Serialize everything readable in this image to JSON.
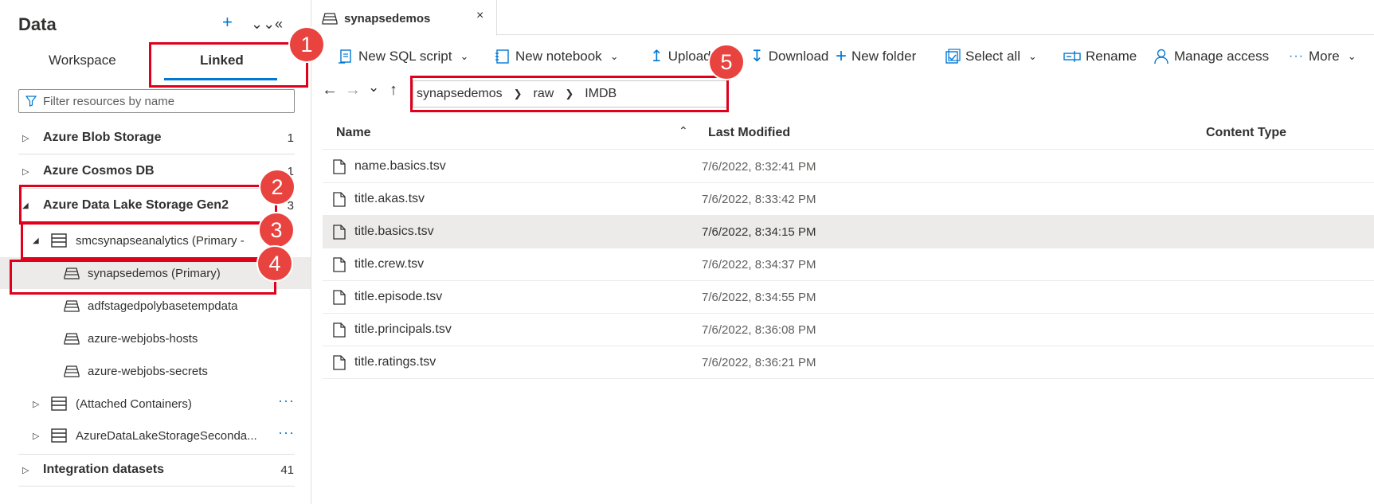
{
  "sidebar": {
    "title": "Data",
    "tabs": [
      "Workspace",
      "Linked"
    ],
    "active_tab": "Linked",
    "filter_placeholder": "Filter resources by name",
    "tree": [
      {
        "label": "Azure Blob Storage",
        "count": "1"
      },
      {
        "label": "Azure Cosmos DB",
        "count": "1"
      },
      {
        "label": "Azure Data Lake Storage Gen2",
        "count": "3"
      },
      {
        "label": "smcsynapseanalytics (Primary - "
      },
      {
        "label": "synapsedemos (Primary)"
      },
      {
        "label": "adfstagedpolybasetempdata"
      },
      {
        "label": "azure-webjobs-hosts"
      },
      {
        "label": "azure-webjobs-secrets"
      },
      {
        "label": "(Attached Containers)"
      },
      {
        "label": "AzureDataLakeStorageSeconda..."
      },
      {
        "label": "Integration datasets",
        "count": "41"
      }
    ]
  },
  "doc_tab": {
    "title": "synapsedemos",
    "close": "×"
  },
  "toolbar": {
    "new_sql_script": "New SQL script",
    "new_notebook": "New notebook",
    "upload": "Upload",
    "download": "Download",
    "new_folder": "New folder",
    "select_all": "Select all",
    "rename": "Rename",
    "manage_access": "Manage access",
    "more": "More"
  },
  "breadcrumb": [
    "synapsedemos",
    "raw",
    "IMDB"
  ],
  "grid": {
    "columns": [
      "Name",
      "Last Modified",
      "Content Type"
    ],
    "rows": [
      {
        "name": "name.basics.tsv",
        "modified": "7/6/2022, 8:32:41 PM"
      },
      {
        "name": "title.akas.tsv",
        "modified": "7/6/2022, 8:33:42 PM"
      },
      {
        "name": "title.basics.tsv",
        "modified": "7/6/2022, 8:34:15 PM"
      },
      {
        "name": "title.crew.tsv",
        "modified": "7/6/2022, 8:34:37 PM"
      },
      {
        "name": "title.episode.tsv",
        "modified": "7/6/2022, 8:34:55 PM"
      },
      {
        "name": "title.principals.tsv",
        "modified": "7/6/2022, 8:36:08 PM"
      },
      {
        "name": "title.ratings.tsv",
        "modified": "7/6/2022, 8:36:21 PM"
      }
    ]
  },
  "callouts": [
    "1",
    "2",
    "3",
    "4",
    "5"
  ],
  "colors": {
    "accent": "#0078d4",
    "callout": "#e0001b",
    "badge": "#e8433f"
  }
}
